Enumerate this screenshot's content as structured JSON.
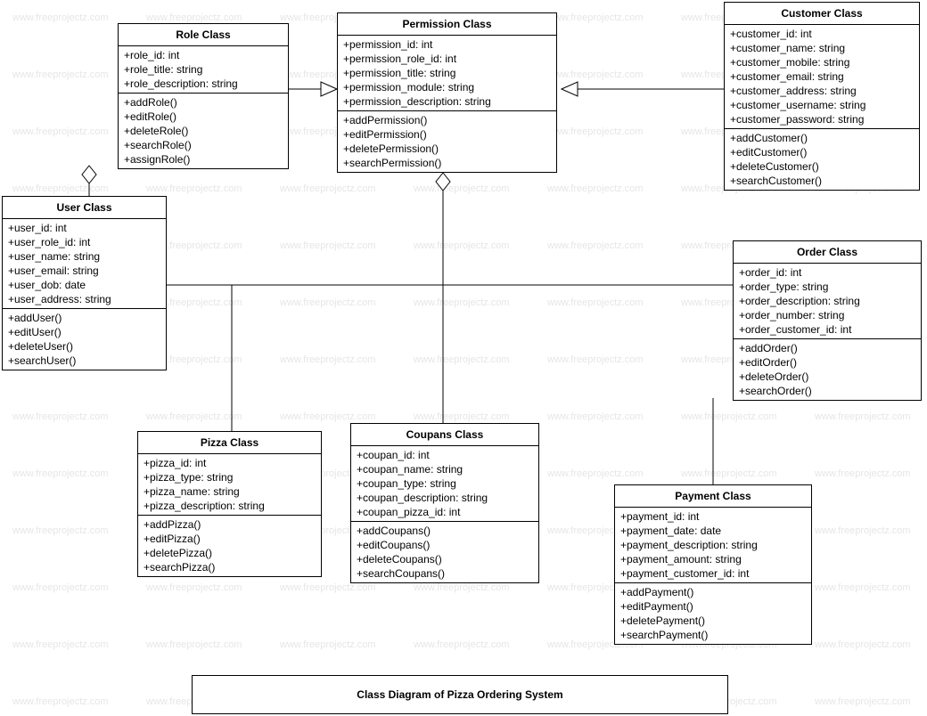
{
  "watermark_text": "www.freeprojectz.com",
  "caption": "Class Diagram of Pizza Ordering System",
  "classes": {
    "role": {
      "title": "Role Class",
      "attrs": [
        "+role_id: int",
        "+role_title: string",
        "+role_description: string"
      ],
      "ops": [
        "+addRole()",
        "+editRole()",
        "+deleteRole()",
        "+searchRole()",
        "+assignRole()"
      ]
    },
    "permission": {
      "title": "Permission Class",
      "attrs": [
        "+permission_id: int",
        "+permission_role_id: int",
        "+permission_title: string",
        "+permission_module: string",
        "+permission_description: string"
      ],
      "ops": [
        "+addPermission()",
        "+editPermission()",
        "+deletePermission()",
        "+searchPermission()"
      ]
    },
    "customer": {
      "title": "Customer Class",
      "attrs": [
        "+customer_id: int",
        "+customer_name: string",
        "+customer_mobile: string",
        "+customer_email: string",
        "+customer_address: string",
        "+customer_username: string",
        "+customer_password: string"
      ],
      "ops": [
        "+addCustomer()",
        "+editCustomer()",
        "+deleteCustomer()",
        "+searchCustomer()"
      ]
    },
    "user": {
      "title": "User Class",
      "attrs": [
        "+user_id: int",
        "+user_role_id: int",
        "+user_name: string",
        "+user_email: string",
        "+user_dob: date",
        "+user_address: string"
      ],
      "ops": [
        "+addUser()",
        "+editUser()",
        "+deleteUser()",
        "+searchUser()"
      ]
    },
    "order": {
      "title": "Order Class",
      "attrs": [
        "+order_id: int",
        "+order_type: string",
        "+order_description: string",
        "+order_number: string",
        "+order_customer_id: int"
      ],
      "ops": [
        "+addOrder()",
        "+editOrder()",
        "+deleteOrder()",
        "+searchOrder()"
      ]
    },
    "pizza": {
      "title": "Pizza Class",
      "attrs": [
        "+pizza_id: int",
        "+pizza_type: string",
        "+pizza_name: string",
        "+pizza_description: string"
      ],
      "ops": [
        "+addPizza()",
        "+editPizza()",
        "+deletePizza()",
        "+searchPizza()"
      ]
    },
    "coupans": {
      "title": "Coupans  Class",
      "attrs": [
        "+coupan_id: int",
        "+coupan_name: string",
        "+coupan_type: string",
        "+coupan_description: string",
        "+coupan_pizza_id: int"
      ],
      "ops": [
        "+addCoupans()",
        "+editCoupans()",
        "+deleteCoupans()",
        "+searchCoupans()"
      ]
    },
    "payment": {
      "title": "Payment Class",
      "attrs": [
        "+payment_id: int",
        "+payment_date: date",
        "+payment_description: string",
        "+payment_amount: string",
        "+payment_customer_id: int"
      ],
      "ops": [
        "+addPayment()",
        "+editPayment()",
        "+deletePayment()",
        "+searchPayment()"
      ]
    }
  },
  "chart_data": {
    "type": "uml-class-diagram",
    "title": "Class Diagram of Pizza Ordering System",
    "classes": [
      {
        "name": "Role",
        "attributes": [
          {
            "name": "role_id",
            "type": "int",
            "vis": "+"
          },
          {
            "name": "role_title",
            "type": "string",
            "vis": "+"
          },
          {
            "name": "role_description",
            "type": "string",
            "vis": "+"
          }
        ],
        "operations": [
          "addRole",
          "editRole",
          "deleteRole",
          "searchRole",
          "assignRole"
        ]
      },
      {
        "name": "Permission",
        "attributes": [
          {
            "name": "permission_id",
            "type": "int",
            "vis": "+"
          },
          {
            "name": "permission_role_id",
            "type": "int",
            "vis": "+"
          },
          {
            "name": "permission_title",
            "type": "string",
            "vis": "+"
          },
          {
            "name": "permission_module",
            "type": "string",
            "vis": "+"
          },
          {
            "name": "permission_description",
            "type": "string",
            "vis": "+"
          }
        ],
        "operations": [
          "addPermission",
          "editPermission",
          "deletePermission",
          "searchPermission"
        ]
      },
      {
        "name": "Customer",
        "attributes": [
          {
            "name": "customer_id",
            "type": "int",
            "vis": "+"
          },
          {
            "name": "customer_name",
            "type": "string",
            "vis": "+"
          },
          {
            "name": "customer_mobile",
            "type": "string",
            "vis": "+"
          },
          {
            "name": "customer_email",
            "type": "string",
            "vis": "+"
          },
          {
            "name": "customer_address",
            "type": "string",
            "vis": "+"
          },
          {
            "name": "customer_username",
            "type": "string",
            "vis": "+"
          },
          {
            "name": "customer_password",
            "type": "string",
            "vis": "+"
          }
        ],
        "operations": [
          "addCustomer",
          "editCustomer",
          "deleteCustomer",
          "searchCustomer"
        ]
      },
      {
        "name": "User",
        "attributes": [
          {
            "name": "user_id",
            "type": "int",
            "vis": "+"
          },
          {
            "name": "user_role_id",
            "type": "int",
            "vis": "+"
          },
          {
            "name": "user_name",
            "type": "string",
            "vis": "+"
          },
          {
            "name": "user_email",
            "type": "string",
            "vis": "+"
          },
          {
            "name": "user_dob",
            "type": "date",
            "vis": "+"
          },
          {
            "name": "user_address",
            "type": "string",
            "vis": "+"
          }
        ],
        "operations": [
          "addUser",
          "editUser",
          "deleteUser",
          "searchUser"
        ]
      },
      {
        "name": "Order",
        "attributes": [
          {
            "name": "order_id",
            "type": "int",
            "vis": "+"
          },
          {
            "name": "order_type",
            "type": "string",
            "vis": "+"
          },
          {
            "name": "order_description",
            "type": "string",
            "vis": "+"
          },
          {
            "name": "order_number",
            "type": "string",
            "vis": "+"
          },
          {
            "name": "order_customer_id",
            "type": "int",
            "vis": "+"
          }
        ],
        "operations": [
          "addOrder",
          "editOrder",
          "deleteOrder",
          "searchOrder"
        ]
      },
      {
        "name": "Pizza",
        "attributes": [
          {
            "name": "pizza_id",
            "type": "int",
            "vis": "+"
          },
          {
            "name": "pizza_type",
            "type": "string",
            "vis": "+"
          },
          {
            "name": "pizza_name",
            "type": "string",
            "vis": "+"
          },
          {
            "name": "pizza_description",
            "type": "string",
            "vis": "+"
          }
        ],
        "operations": [
          "addPizza",
          "editPizza",
          "deletePizza",
          "searchPizza"
        ]
      },
      {
        "name": "Coupans",
        "attributes": [
          {
            "name": "coupan_id",
            "type": "int",
            "vis": "+"
          },
          {
            "name": "coupan_name",
            "type": "string",
            "vis": "+"
          },
          {
            "name": "coupan_type",
            "type": "string",
            "vis": "+"
          },
          {
            "name": "coupan_description",
            "type": "string",
            "vis": "+"
          },
          {
            "name": "coupan_pizza_id",
            "type": "int",
            "vis": "+"
          }
        ],
        "operations": [
          "addCoupans",
          "editCoupans",
          "deleteCoupans",
          "searchCoupans"
        ]
      },
      {
        "name": "Payment",
        "attributes": [
          {
            "name": "payment_id",
            "type": "int",
            "vis": "+"
          },
          {
            "name": "payment_date",
            "type": "date",
            "vis": "+"
          },
          {
            "name": "payment_description",
            "type": "string",
            "vis": "+"
          },
          {
            "name": "payment_amount",
            "type": "string",
            "vis": "+"
          },
          {
            "name": "payment_customer_id",
            "type": "int",
            "vis": "+"
          }
        ],
        "operations": [
          "addPayment",
          "editPayment",
          "deletePayment",
          "searchPayment"
        ]
      }
    ],
    "relationships": [
      {
        "from": "Role",
        "to": "User",
        "type": "aggregation",
        "end": "Role"
      },
      {
        "from": "Role",
        "to": "Permission",
        "type": "generalization",
        "end": "Permission"
      },
      {
        "from": "Permission",
        "to": "Customer",
        "type": "generalization",
        "end": "Permission"
      },
      {
        "from": "Permission",
        "to": "Coupans",
        "type": "aggregation",
        "end": "Permission"
      },
      {
        "from": "User",
        "to": "Pizza",
        "type": "association"
      },
      {
        "from": "User",
        "to": "Order",
        "type": "association"
      },
      {
        "from": "Order",
        "to": "Payment",
        "type": "association"
      }
    ]
  }
}
